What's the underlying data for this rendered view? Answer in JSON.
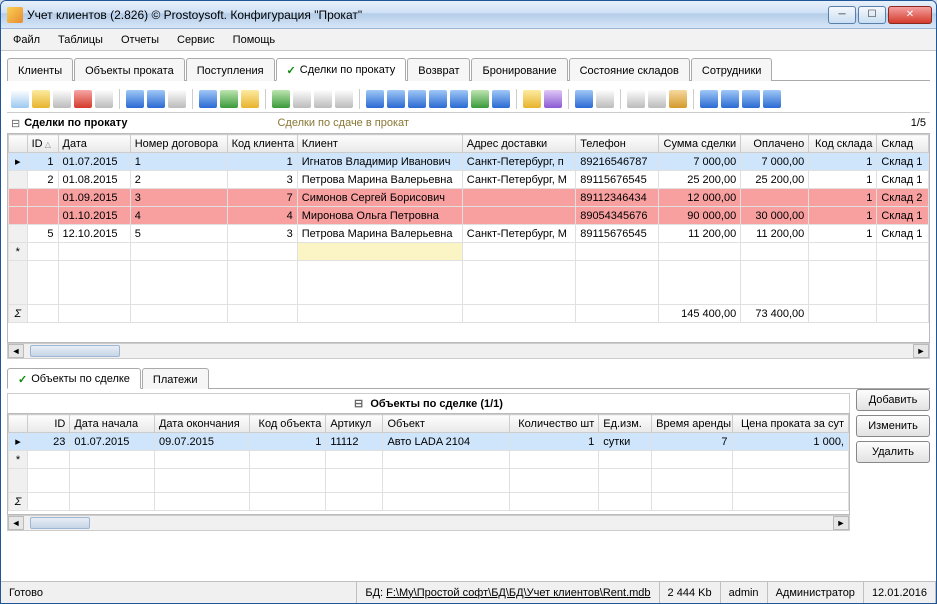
{
  "window": {
    "title": "Учет клиентов (2.826) © Prostoysoft. Конфигурация \"Прокат\""
  },
  "menu": [
    "Файл",
    "Таблицы",
    "Отчеты",
    "Сервис",
    "Помощь"
  ],
  "tabs": [
    {
      "label": "Клиенты",
      "active": false
    },
    {
      "label": "Объекты проката",
      "active": false
    },
    {
      "label": "Поступления",
      "active": false
    },
    {
      "label": "Сделки по прокату",
      "active": true,
      "check": true
    },
    {
      "label": "Возврат",
      "active": false
    },
    {
      "label": "Бронирование",
      "active": false
    },
    {
      "label": "Состояние складов",
      "active": false
    },
    {
      "label": "Сотрудники",
      "active": false
    }
  ],
  "section": {
    "title": "Сделки по прокату",
    "subtitle": "Сделки по сдаче в прокат",
    "pager": "1/5"
  },
  "main_columns": [
    "ID",
    "Дата",
    "Номер договора",
    "Код клиента",
    "Клиент",
    "Адрес доставки",
    "Телефон",
    "Сумма сделки",
    "Оплачено",
    "Код склада",
    "Склад"
  ],
  "main_rows": [
    {
      "sel": true,
      "id": "1",
      "date": "01.07.2015",
      "contract": "1",
      "clientcode": "1",
      "client": "Игнатов Владимир Иванович",
      "addr": "Санкт-Петербург, п",
      "phone": "89216546787",
      "sum": "7 000,00",
      "paid": "7 000,00",
      "whcode": "1",
      "wh": "Склад 1"
    },
    {
      "id": "2",
      "date": "01.08.2015",
      "contract": "2",
      "clientcode": "3",
      "client": "Петрова Марина Валерьевна",
      "addr": "Санкт-Петербург, М",
      "phone": "89115676545",
      "sum": "25 200,00",
      "paid": "25 200,00",
      "whcode": "1",
      "wh": "Склад 1"
    },
    {
      "red": true,
      "id": "",
      "date": "01.09.2015",
      "contract": "3",
      "clientcode": "7",
      "client": "Симонов Сергей Борисович",
      "addr": "",
      "phone": "89112346434",
      "sum": "12 000,00",
      "paid": "",
      "whcode": "1",
      "wh": "Склад 2"
    },
    {
      "red": true,
      "id": "",
      "date": "01.10.2015",
      "contract": "4",
      "clientcode": "4",
      "client": "Миронова Ольга Петровна",
      "addr": "",
      "phone": "89054345676",
      "sum": "90 000,00",
      "paid": "30 000,00",
      "whcode": "1",
      "wh": "Склад 1"
    },
    {
      "id": "5",
      "date": "12.10.2015",
      "contract": "5",
      "clientcode": "3",
      "client": "Петрова Марина Валерьевна",
      "addr": "Санкт-Петербург, М",
      "phone": "89115676545",
      "sum": "11 200,00",
      "paid": "11 200,00",
      "whcode": "1",
      "wh": "Склад 1"
    }
  ],
  "totals": {
    "sum": "145 400,00",
    "paid": "73 400,00"
  },
  "subtabs": [
    {
      "label": "Объекты по сделке",
      "active": true,
      "check": true
    },
    {
      "label": "Платежи",
      "active": false
    }
  ],
  "detail": {
    "title": "Объекты по сделке (1/1)",
    "columns": [
      "ID",
      "Дата начала",
      "Дата окончания",
      "Код объекта",
      "Артикул",
      "Объект",
      "Количество шт",
      "Ед.изм.",
      "Время аренды",
      "Цена проката за сут"
    ],
    "rows": [
      {
        "id": "23",
        "start": "01.07.2015",
        "end": "09.07.2015",
        "code": "1",
        "art": "11112",
        "obj": "Авто LADA 2104",
        "qty": "1",
        "unit": "сутки",
        "time": "7",
        "price": "1 000,"
      }
    ],
    "buttons": [
      "Добавить",
      "Изменить",
      "Удалить"
    ]
  },
  "status": {
    "ready": "Готово",
    "db_label": "БД:",
    "db_path": "F:\\My\\Простой софт\\БД\\БД\\Учет клиентов\\Rent.mdb",
    "size": "2 444 Kb",
    "user": "admin",
    "role": "Администратор",
    "date": "12.01.2016"
  }
}
